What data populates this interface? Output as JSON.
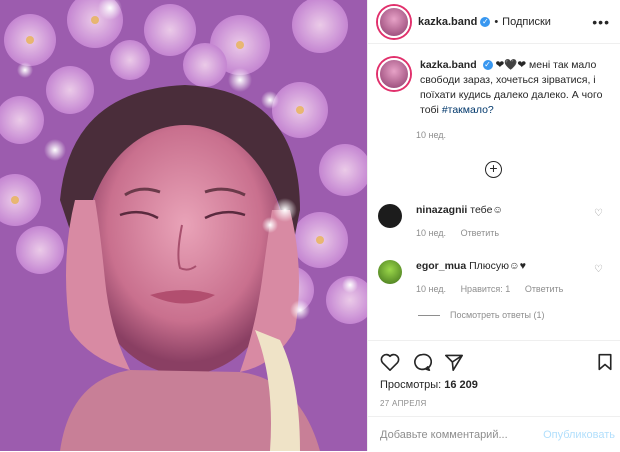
{
  "header": {
    "username": "kazka.band",
    "separator": "•",
    "follow_label": "Подписки",
    "more": "•••"
  },
  "caption": {
    "username": "kazka.band",
    "emoji": "❤🖤❤",
    "text": "мені так мало свободи зараз, хочеться зірватися, і поїхати кудись далеко далеко. А чого тобі",
    "hashtag": "#такмало?",
    "time": "10 нед."
  },
  "load_more": "+",
  "comments": [
    {
      "username": "ninazagnii",
      "text": "тебе☺",
      "time": "10 нед.",
      "reply": "Ответить",
      "likes": ""
    },
    {
      "username": "egor_mua",
      "text": "Плюсую☺♥",
      "time": "10 нед.",
      "likes": "Нравится: 1",
      "reply": "Ответить"
    }
  ],
  "replies_label": "Посмотреть ответы (1)",
  "views": {
    "label": "Просмотры:",
    "count": "16 209"
  },
  "date": "27 АПРЕЛЯ",
  "add_comment": {
    "placeholder": "Добавьте комментарий...",
    "post_label": "Опубликовать"
  },
  "colors": {
    "verified": "#3897f0",
    "link": "#00376b",
    "post_disabled": "#b2dffc"
  }
}
